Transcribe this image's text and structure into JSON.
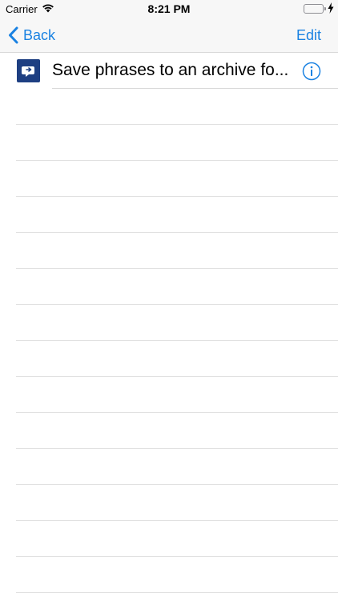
{
  "status_bar": {
    "carrier": "Carrier",
    "time": "8:21 PM",
    "wifi_icon": "wifi-icon",
    "battery_icon": "battery-icon",
    "battery_color": "#4cd964"
  },
  "nav": {
    "back_label": "Back",
    "edit_label": "Edit",
    "tint_color": "#1a82e2"
  },
  "list": {
    "items": [
      {
        "title": "Save phrases to an archive fo...",
        "icon": "phrase-archive-icon",
        "accessory": "info-icon"
      }
    ],
    "empty_rows": 14
  }
}
